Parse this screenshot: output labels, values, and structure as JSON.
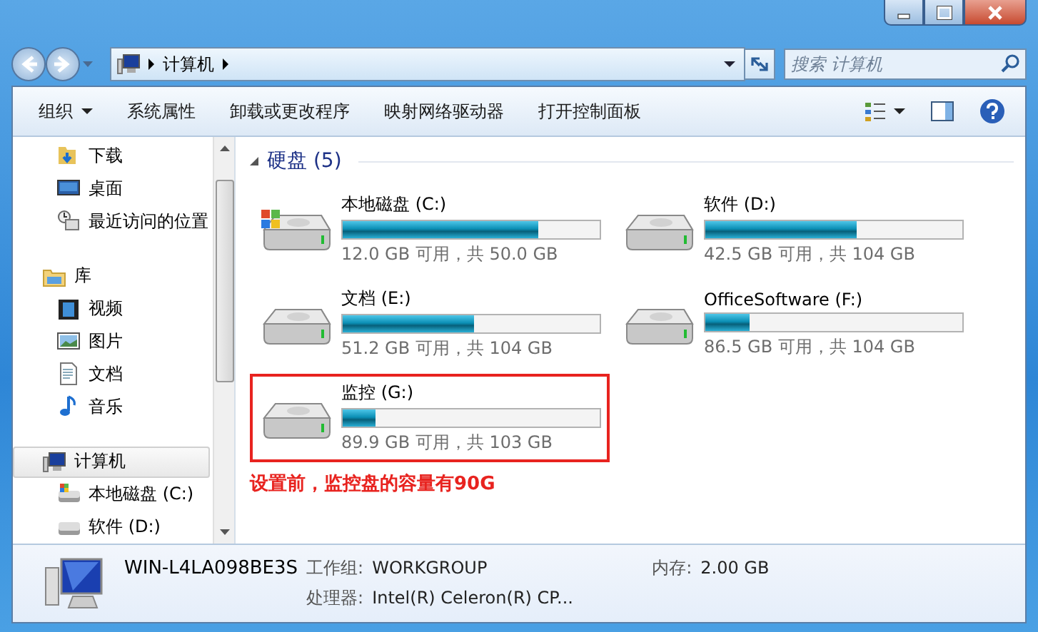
{
  "address": {
    "path": [
      "计算机"
    ]
  },
  "search": {
    "placeholder": "搜索 计算机"
  },
  "toolbar": {
    "items": [
      {
        "label": "组织",
        "menu": true
      },
      {
        "label": "系统属性",
        "menu": false
      },
      {
        "label": "卸载或更改程序",
        "menu": false
      },
      {
        "label": "映射网络驱动器",
        "menu": false
      },
      {
        "label": "打开控制面板",
        "menu": false
      }
    ]
  },
  "nav": {
    "items": [
      {
        "label": "下载",
        "selected": false
      },
      {
        "label": "桌面",
        "selected": false
      },
      {
        "label": "最近访问的位置",
        "selected": false
      },
      {
        "label": "库",
        "selected": false,
        "children": [
          {
            "label": "视频",
            "selected": false
          },
          {
            "label": "图片",
            "selected": false
          },
          {
            "label": "文档",
            "selected": false
          },
          {
            "label": "音乐",
            "selected": false
          }
        ]
      },
      {
        "label": "计算机",
        "selected": true,
        "children": [
          {
            "label": "本地磁盘 (C:)",
            "selected": false
          },
          {
            "label": "软件 (D:)",
            "selected": false
          }
        ]
      }
    ]
  },
  "section": {
    "title": "硬盘 (5)",
    "expanded": true,
    "drives": [
      {
        "name": "本地磁盘 (C:)",
        "kind": "system",
        "level": 0.76,
        "space": "12.0 GB 可用，共 50.0 GB",
        "highlighted": false
      },
      {
        "name": "软件 (D:)",
        "kind": "data",
        "level": 0.59,
        "space": "42.5 GB 可用，共 104 GB",
        "highlighted": false
      },
      {
        "name": "文档 (E:)",
        "kind": "data",
        "level": 0.51,
        "space": "51.2 GB 可用，共 104 GB",
        "highlighted": false
      },
      {
        "name": "OfficeSoftware (F:)",
        "kind": "data",
        "level": 0.17,
        "space": "86.5 GB 可用，共 104 GB",
        "highlighted": false
      },
      {
        "name": "监控 (G:)",
        "kind": "data",
        "level": 0.13,
        "space": "89.9 GB 可用，共 103 GB",
        "highlighted": true
      }
    ]
  },
  "annotation": "设置前，监控盘的容量有90G",
  "details": {
    "computer_name": "WIN-L4LA098BE3S",
    "fields": [
      {
        "label": "工作组:",
        "value": "WORKGROUP"
      },
      {
        "label": "内存:",
        "value": "2.00 GB"
      },
      {
        "label": "处理器:",
        "value": "Intel(R) Celeron(R) CP..."
      }
    ]
  }
}
